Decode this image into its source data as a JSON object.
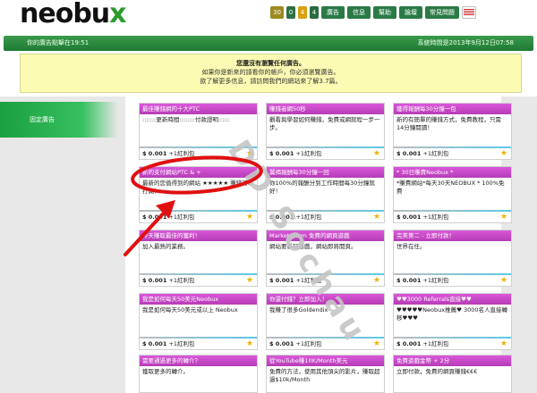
{
  "header": {
    "logo_main": "neobu",
    "logo_x": "x",
    "badges": [
      "30",
      "0",
      "4",
      "4"
    ],
    "menu": [
      "廣告",
      "信息",
      "幫助",
      "論壇",
      "常見問題"
    ],
    "flag_icon": "us-flag-icon"
  },
  "status": {
    "left": "你的廣告點擊在19:51",
    "right": "系統時間是2013年9月12日07:58"
  },
  "notice": {
    "title": "您還沒有瀏覽任何廣告。",
    "lines": [
      "如果你是新來的請看你的帳戶，你必須瀏覽廣告。",
      "欲了解更多信息，請訪問我們的網站來了解3.7篇。"
    ]
  },
  "sidebar": {
    "active_tab": "固定廣告"
  },
  "ads": [
    {
      "title": "最佳賺錢網的十大PTC",
      "body": ":::::::更新時間::::::::付款證明::::::",
      "price": "$ 0.001",
      "bonus": "+1紅利包"
    },
    {
      "title": "賺錢者網50秒",
      "body": "觀看與學習如何賺錢，免費或網就程一步一步。",
      "price": "$ 0.001",
      "bonus": "+1紅利包"
    },
    {
      "title": "獲得報酬每30分鐘一包",
      "body": "新的有簡單的賺錢方式，免費教程，只需14分鐘閱讀！",
      "price": "$ 0.001",
      "bonus": "+1紅利包"
    },
    {
      "title": "新的支付網站PTC & +",
      "body": "最新的您值得到的網站 ★★★★★ 賺錢可以打開！",
      "price": "$ 0.001",
      "bonus": "+1紅利包"
    },
    {
      "title": "翼揭報酬每30分鐘一回",
      "body": "你100%的報酬分到工作時間每30分鐘就好！",
      "price": "$ 0.001",
      "bonus": "+1紅利包"
    },
    {
      "title": "* 30日賺費Neobux *",
      "body": "*賺費網站*每天30天NEOBUX * 100%免費",
      "price": "$ 0.001",
      "bonus": "+1紅利包"
    },
    {
      "title": "今天賺取最佳的獲利！",
      "body": "加入最熱的業務。",
      "price": "$ 0.001",
      "bonus": "+1紅利包"
    },
    {
      "title": "MarketStorm 免費的網頁遊戲",
      "body": "網站要新玩遊戲，網站即將開頁。",
      "price": "$ 0.001",
      "bonus": "+1紅利包"
    },
    {
      "title": "完美第二 - 立即付款！",
      "body": "世界在任。",
      "price": "$ 0.001",
      "bonus": "+1紅利包"
    },
    {
      "title": "我是如何每天50美元Neobux",
      "body": "我是如何每天50美元或以上 Neobux",
      "price": "$ 0.001",
      "bonus": "+1紅利包"
    },
    {
      "title": "你還付錢？立即加入！",
      "body": "我賺了很多Goldendix",
      "price": "$ 0.001",
      "bonus": "+1紅利包"
    },
    {
      "title": "♥♥3000 Referrals直接♥♥",
      "body": "♥♥♥♥♥Neobux推薦♥ 3000名人直接轉移♥♥♥",
      "price": "$ 0.001",
      "bonus": "+1紅利包"
    },
    {
      "title": "需要通過更多的轉介？",
      "body": "獲取更多的轉介。",
      "price": "",
      "bonus": ""
    },
    {
      "title": "從YouTube賺10K/Month美元",
      "body": "免費的方法，使用其他頂尖的影片，賺取超過$10k/Month",
      "price": "",
      "bonus": ""
    },
    {
      "title": "免費遊戲金幣 + 2分",
      "body": "立即付款，免費的網頁賺錢€€€",
      "price": "",
      "bonus": ""
    }
  ],
  "watermark": "DD Sochau"
}
